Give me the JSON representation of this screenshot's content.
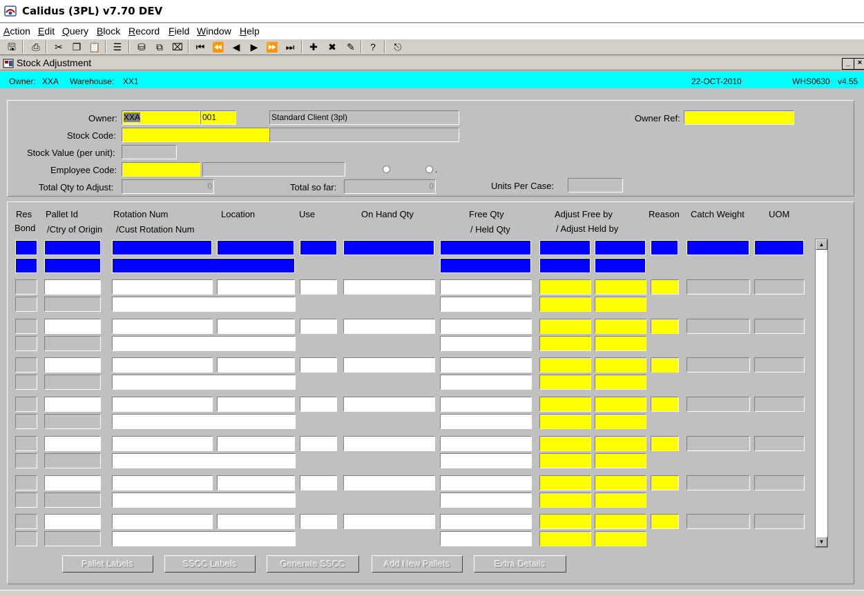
{
  "app_title": "Calidus (3PL) v7.70 DEV",
  "menu": [
    "Action",
    "Edit",
    "Query",
    "Block",
    "Record",
    "Field",
    "Window",
    "Help"
  ],
  "menu_underline": [
    "A",
    "E",
    "Q",
    "B",
    "R",
    "F",
    "W",
    "H"
  ],
  "toolbar_icons": [
    "save-icon",
    "print-icon",
    "cut-icon",
    "copy-icon",
    "paste-icon",
    "list-icon",
    "query-icon",
    "copy-record-icon",
    "clear-icon",
    "first-record-icon",
    "previous-block-icon",
    "previous-record-icon",
    "next-record-icon",
    "next-block-icon",
    "last-record-icon",
    "insert-record-icon",
    "delete-record-icon",
    "clear-record-icon",
    "help-icon",
    "exit-icon"
  ],
  "window_title": "Stock Adjustment",
  "window_buttons": {
    "minimize": "_",
    "close": "×"
  },
  "infobar": {
    "owner_label": "Owner:",
    "owner": "XXA",
    "warehouse_label": "Warehouse:",
    "warehouse": "XX1",
    "date": "22-OCT-2010",
    "form_id": "WHS0630",
    "version": "v4.55"
  },
  "header": {
    "owner_label": "Owner:",
    "owner_value": "XXA",
    "owner_suffix": "001",
    "owner_name": "Standard Client (3pl)",
    "owner_ref_label": "Owner Ref:",
    "stock_code_label": "Stock Code:",
    "stock_value_label": "Stock Value (per unit):",
    "employee_code_label": "Employee Code:",
    "radio_dot": ".",
    "total_qty_label": "Total Qty to Adjust:",
    "total_qty_value": "0",
    "total_so_far_label": "Total so far:",
    "total_so_far_value": "0",
    "units_per_case_label": "Units Per Case:"
  },
  "columns": {
    "res": "Res",
    "bond": "Bond",
    "pallet_id": "Pallet Id",
    "ctry_origin": "/Ctry of Origin",
    "rotation_num": "Rotation Num",
    "cust_rotation": "/Cust Rotation Num",
    "location": "Location",
    "use": "Use",
    "on_hand": "On Hand Qty",
    "free_qty": "Free Qty",
    "held_qty": "/ Held Qty",
    "adjust_free": "Adjust Free by",
    "adjust_held": "/ Adjust Held by",
    "reason": "Reason",
    "catch_weight": "Catch Weight",
    "uom": "UOM"
  },
  "data_rows": 7,
  "buttons": [
    "Pallet Labels",
    "SSCC Labels",
    "Generate SSCC",
    "Add New Pallets",
    "Extra Details"
  ],
  "scroll": {
    "up": "▲",
    "down": "▼"
  },
  "colors": {
    "cyan": "#00ffff",
    "yellow": "#ffff00",
    "blue": "#0000ff",
    "grey": "#c0c0c0"
  }
}
